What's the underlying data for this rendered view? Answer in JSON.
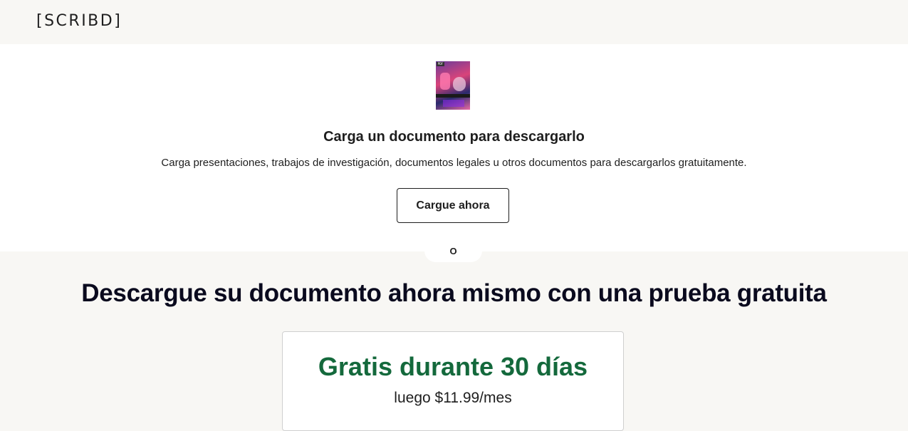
{
  "header": {
    "logo_text": "[SCRIBD]"
  },
  "upload": {
    "thumbnail_tag": "PDF",
    "title": "Carga un documento para descargarlo",
    "description": "Carga presentaciones, trabajos de investigación, documentos legales u otros documentos para descargarlos gratuitamente.",
    "button_label": "Cargue ahora"
  },
  "divider": {
    "or_label": "O"
  },
  "trial": {
    "headline": "Descargue su documento ahora mismo con una prueba gratuita",
    "card_title": "Gratis durante 30 días",
    "card_price": "luego $11.99/mes"
  },
  "colors": {
    "page_background": "#f8f7f4",
    "panel_background": "#ffffff",
    "trial_green": "#14693c",
    "text_dark": "#1e1e1e"
  }
}
